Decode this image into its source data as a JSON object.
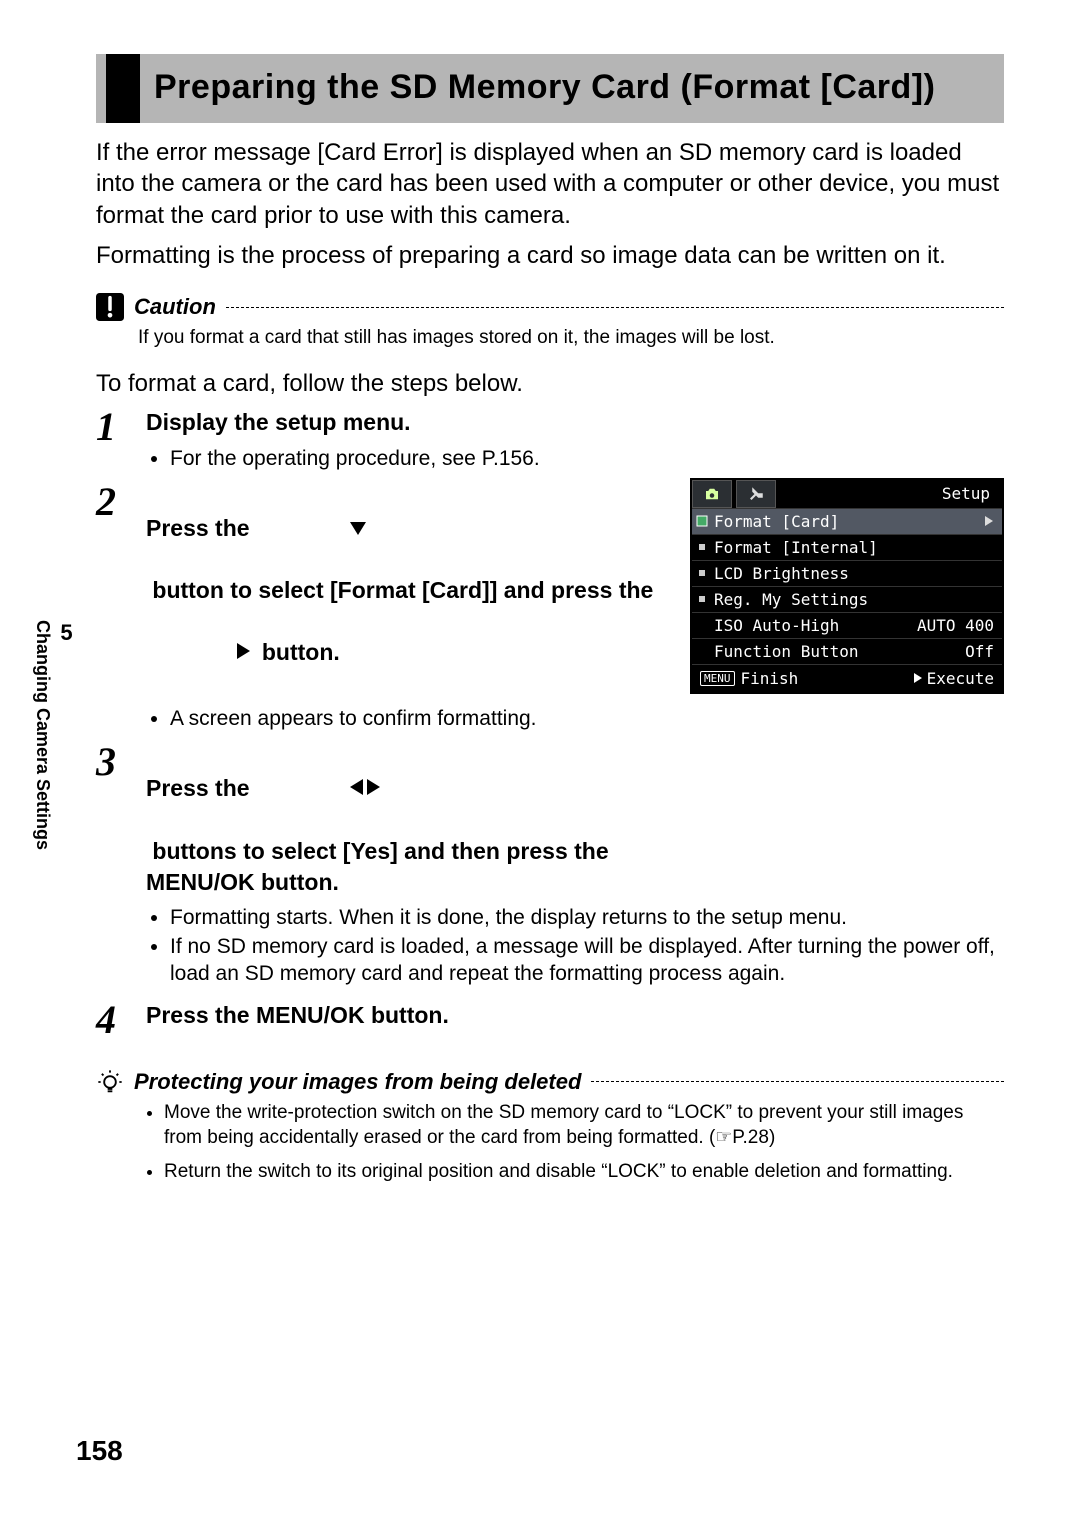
{
  "page_number": "158",
  "side_tab": {
    "number": "5",
    "label": "Changing Camera Settings"
  },
  "title": "Preparing the SD Memory Card (Format [Card])",
  "intro_p1": "If the error message [Card Error] is displayed when an SD memory card is loaded into the camera or the card has been used with a computer or other device, you must format the card prior to use with this camera.",
  "intro_p2": "Formatting is the process of preparing a card so image data can be written on it.",
  "caution": {
    "label": "Caution",
    "body": "If you format a card that still has images stored on it, the images will be lost."
  },
  "lead_in": "To format a card, follow the steps below.",
  "steps": {
    "s1": {
      "num": "1",
      "title": "Display the setup menu.",
      "bullets": [
        "For the operating procedure, see P.156."
      ]
    },
    "s2": {
      "num": "2",
      "title_a": "Press the ",
      "title_b": " button to select [Format [Card]] and press the ",
      "title_c": " button.",
      "bullets": [
        "A screen appears to confirm formatting."
      ]
    },
    "s3": {
      "num": "3",
      "title_a": "Press the ",
      "title_b": " buttons to select [Yes] and then press the MENU/OK button.",
      "bullets": [
        "Formatting starts. When it is done, the display returns to the setup menu.",
        "If no SD memory card is loaded, a message will be displayed. After turning the power off, load an SD memory card and repeat the formatting process again."
      ]
    },
    "s4": {
      "num": "4",
      "title": "Press the MENU/OK button."
    }
  },
  "lcd": {
    "setup_label": "Setup",
    "rows": [
      {
        "label": "Format [Card]",
        "value": "",
        "sel": true,
        "chev": true,
        "dot": "box"
      },
      {
        "label": "Format [Internal]",
        "value": "",
        "sel": false,
        "chev": false,
        "dot": "sq"
      },
      {
        "label": "LCD Brightness",
        "value": "",
        "sel": false,
        "chev": false,
        "dot": "sq"
      },
      {
        "label": "Reg. My Settings",
        "value": "",
        "sel": false,
        "chev": false,
        "dot": "sq"
      },
      {
        "label": "ISO Auto-High",
        "value": "AUTO 400",
        "sel": false,
        "chev": false,
        "dot": ""
      },
      {
        "label": "Function Button",
        "value": "Off",
        "sel": false,
        "chev": false,
        "dot": ""
      }
    ],
    "footer": {
      "menu": "MENU",
      "finish": "Finish",
      "execute": "Execute"
    }
  },
  "tip": {
    "label": "Protecting your images from being deleted",
    "items": [
      "Move the write-protection switch on the SD memory card to “LOCK” to prevent your still images from being accidentally erased or the card from being formatted. (☞P.28)",
      "Return the switch to its original position and disable “LOCK” to enable deletion and formatting."
    ]
  }
}
